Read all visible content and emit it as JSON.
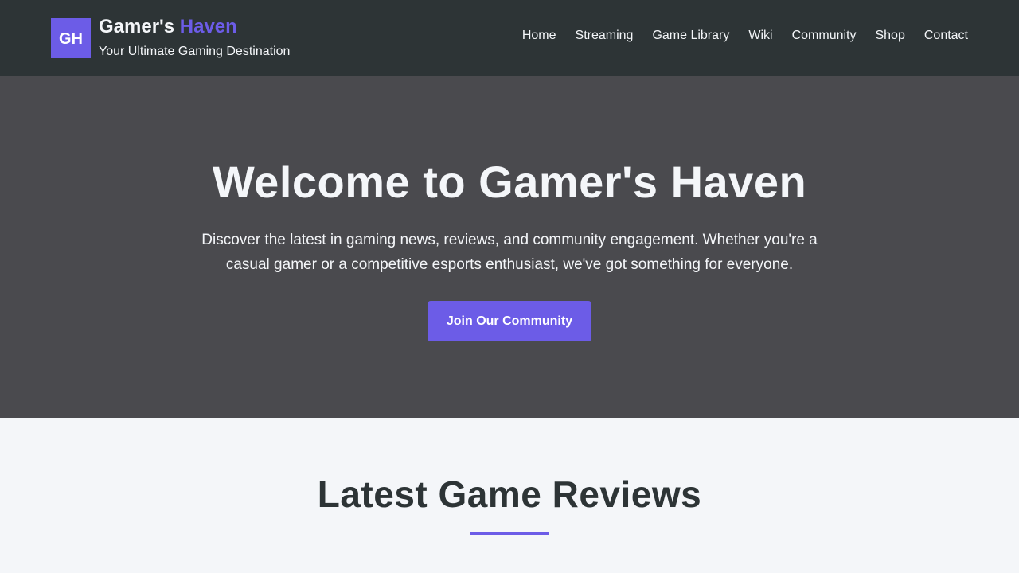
{
  "header": {
    "logo_text": "GH",
    "brand_name": "Gamer's",
    "brand_accent": "Haven",
    "tagline": "Your Ultimate Gaming Destination",
    "nav": [
      "Home",
      "Streaming",
      "Game Library",
      "Wiki",
      "Community",
      "Shop",
      "Contact"
    ]
  },
  "hero": {
    "title": "Welcome to Gamer's Haven",
    "description": "Discover the latest in gaming news, reviews, and community engagement. Whether you're a casual gamer or a competitive esports enthusiast, we've got something for everyone.",
    "cta_label": "Join Our Community"
  },
  "reviews": {
    "title": "Latest Game Reviews"
  },
  "colors": {
    "header_bg": "#2d3436",
    "accent": "#6c5ce7",
    "hero_bg": "#4a4a4e",
    "page_bg": "#f4f6f9",
    "light_text": "#f4f6f9",
    "dark_text": "#2d3436"
  }
}
